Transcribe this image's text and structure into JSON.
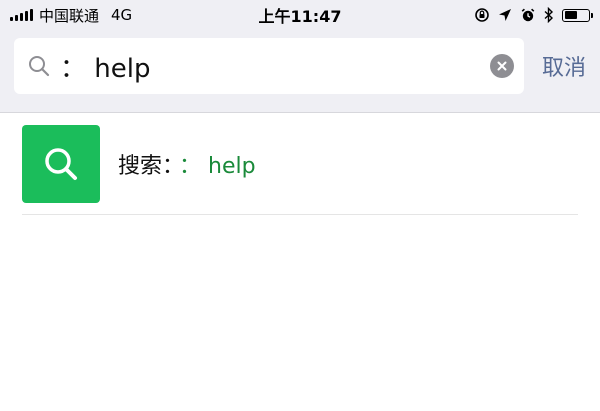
{
  "status_bar": {
    "carrier": "中国联通",
    "network": "4G",
    "time": "上午11:47",
    "battery_fraction": 0.55
  },
  "search": {
    "value": "： help",
    "cancel_label": "取消"
  },
  "results": [
    {
      "prefix": "搜索：",
      "keyword": "： help",
      "icon": "search-icon",
      "icon_color": "#1bbd5b"
    }
  ],
  "colors": {
    "accent_link": "#576b95",
    "keyword": "#1a8a3a",
    "header_bg": "#efeff4"
  }
}
